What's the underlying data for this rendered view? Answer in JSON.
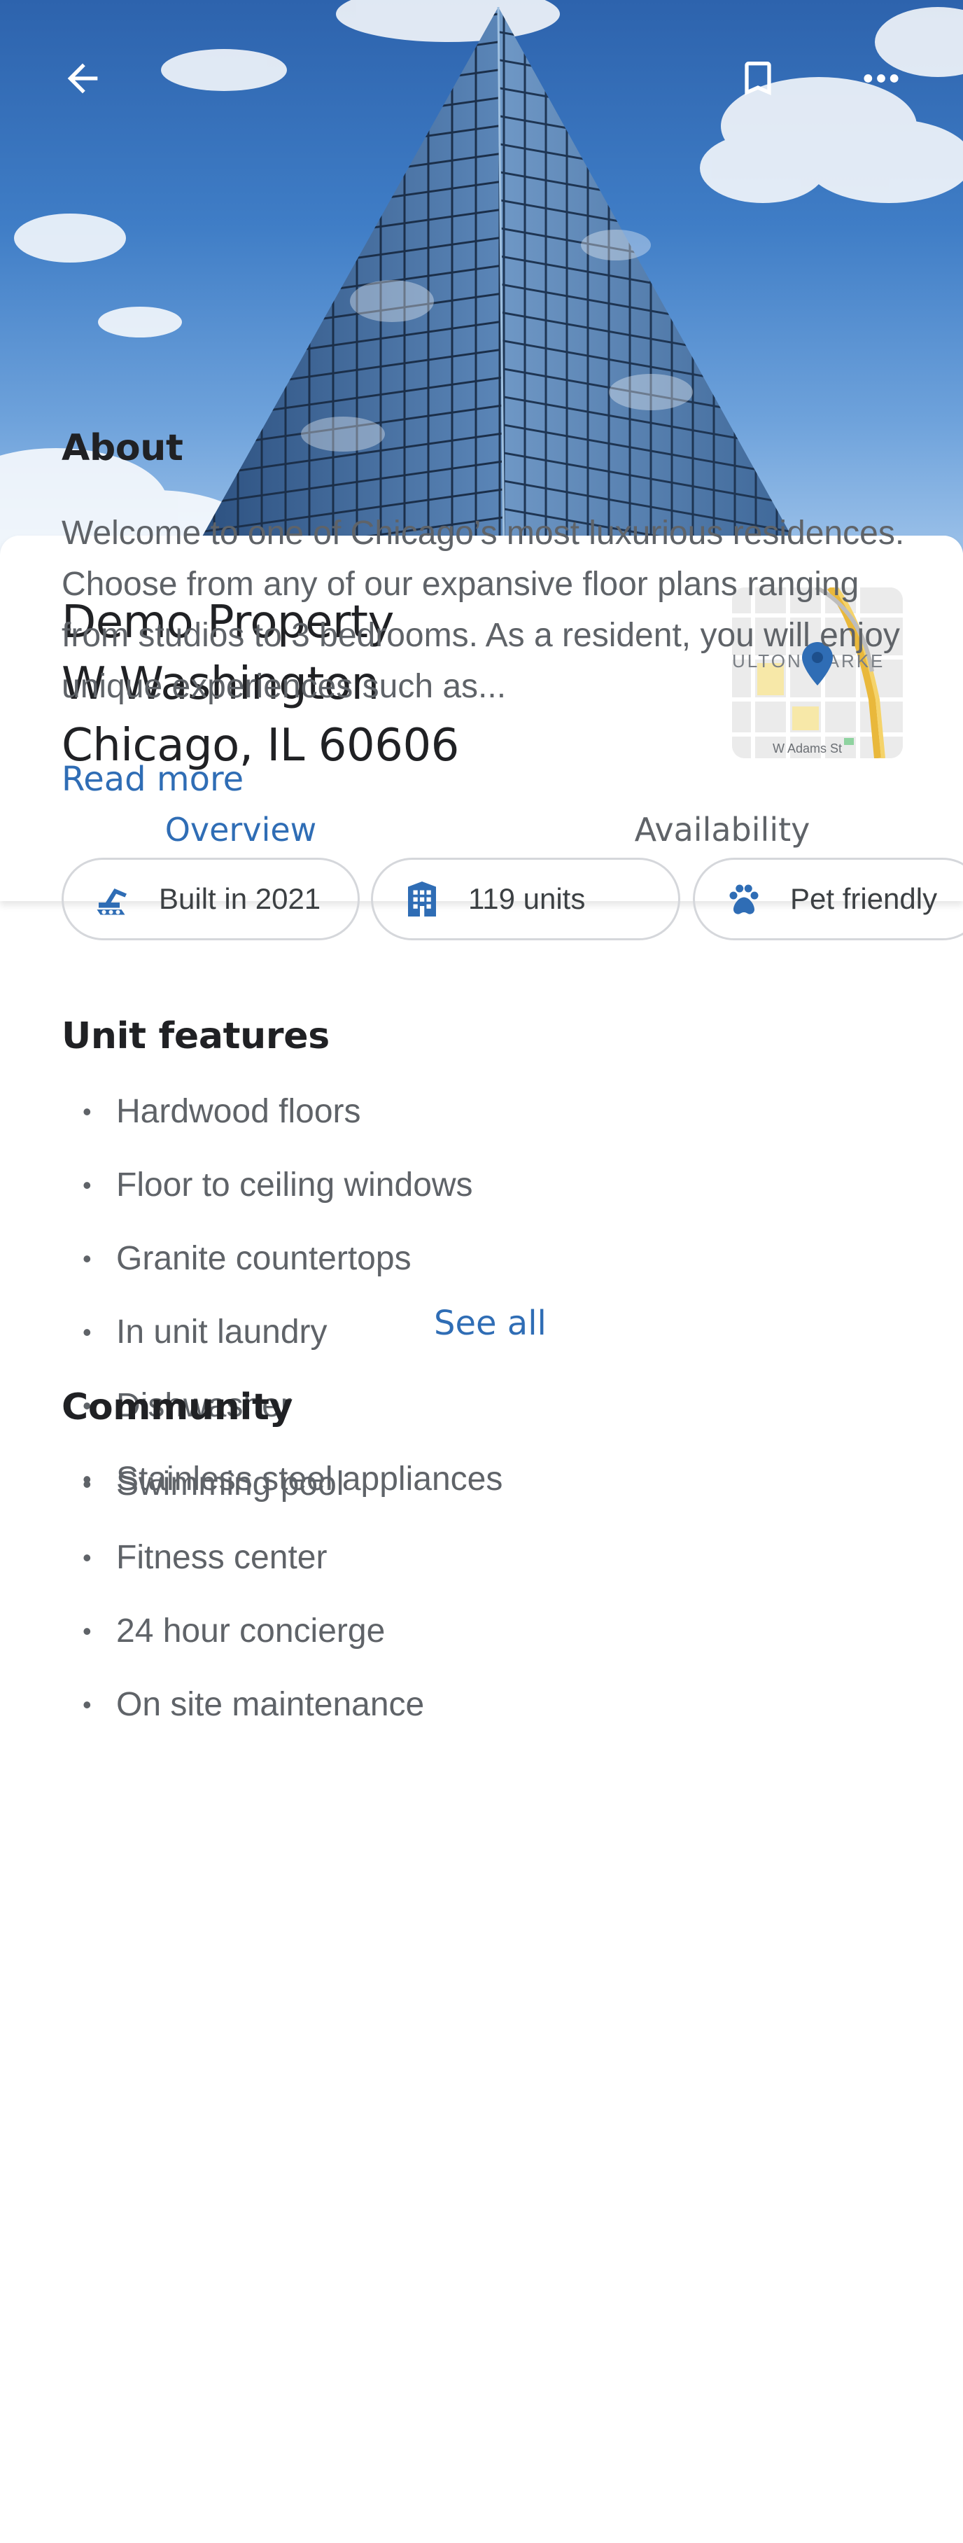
{
  "header": {
    "back_icon": "arrow-back-icon",
    "bookmark_icon": "bookmark-icon",
    "more_icon": "more-horizontal-icon"
  },
  "property": {
    "name": "Demo Property",
    "street": "W Washington",
    "city_line": "Chicago, IL 60606"
  },
  "map_thumb": {
    "label_top": "ULTON MARKE",
    "label_street": "W Adams St"
  },
  "tabs": [
    {
      "label": "Overview",
      "active": true
    },
    {
      "label": "Availability",
      "active": false
    }
  ],
  "about": {
    "title": "About",
    "text": "Welcome to one of Chicago’s most luxurious residences. Choose from any of our expansive floor plans ranging from studios to 3 bedrooms. As a resident, you will enjoy unique experiences such as...",
    "read_more": "Read more"
  },
  "chips": [
    {
      "label": "Built in 2021",
      "icon": "crane-icon"
    },
    {
      "label": "119 units",
      "icon": "building-icon"
    },
    {
      "label": "Pet friendly",
      "icon": "paw-icon"
    },
    {
      "label": "",
      "icon": ""
    }
  ],
  "unit_features": {
    "title": "Unit features",
    "items": [
      "Hardwood floors",
      "Floor to ceiling windows",
      "Granite countertops",
      "In unit laundry",
      "Dishwasher",
      "Stainless steel appliances"
    ],
    "see_all": "See all"
  },
  "community": {
    "title": "Community",
    "items": [
      "Swimming pool",
      "Fitness center",
      "24 hour concierge",
      "On site maintenance"
    ]
  },
  "colors": {
    "accent": "#2f6db5",
    "text_primary": "#202124",
    "text_secondary": "#5f6368",
    "chip_border": "#d5d7db"
  }
}
